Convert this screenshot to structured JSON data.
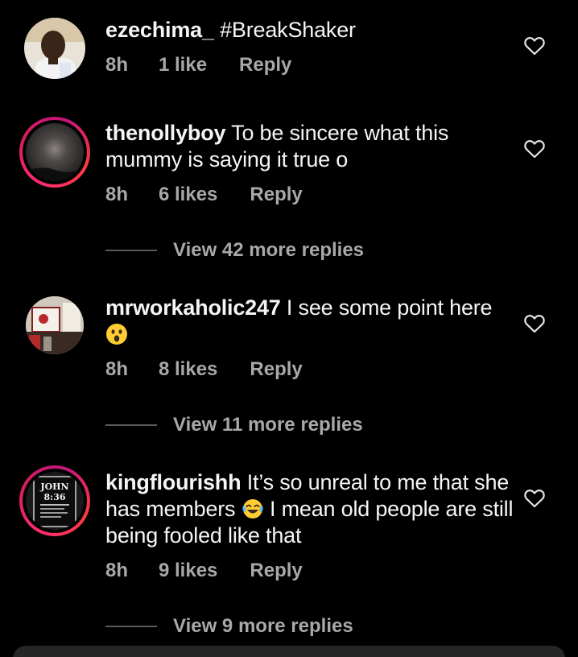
{
  "comments": [
    {
      "username": "ezechima_",
      "text": "#BreakShaker",
      "time": "8h",
      "likes": "1 like",
      "reply": "Reply",
      "avatar": "person-photo"
    },
    {
      "username": "thenollyboy",
      "text": "To be sincere what this mummy is saying it true o",
      "time": "8h",
      "likes": "6 likes",
      "reply": "Reply",
      "more_replies": "View 42 more replies",
      "avatar": "night-moon-photo"
    },
    {
      "username": "mrworkaholic247",
      "text": "I see some point here",
      "emoji": "astonished-face",
      "time": "8h",
      "likes": "8 likes",
      "reply": "Reply",
      "more_replies": "View 11 more replies",
      "avatar": "shelf-photo"
    },
    {
      "username": "kingflourishh",
      "text_part1": "It’s so unreal to me that she has members",
      "emoji": "tears-of-joy-face",
      "text_part2": "I mean old people are still being fooled like that",
      "time": "8h",
      "likes": "9 likes",
      "reply": "Reply",
      "more_replies": "View 9 more replies",
      "avatar": "john-836-badge",
      "avatar_text_line1": "JOHN",
      "avatar_text_line2": "8:36"
    }
  ],
  "icons": {
    "like": "heart-outline-icon"
  },
  "colors": {
    "background": "#000000",
    "primary_text": "#f5f5f5",
    "secondary_text": "#a8a8a8",
    "story_ring": "#e1306c"
  }
}
